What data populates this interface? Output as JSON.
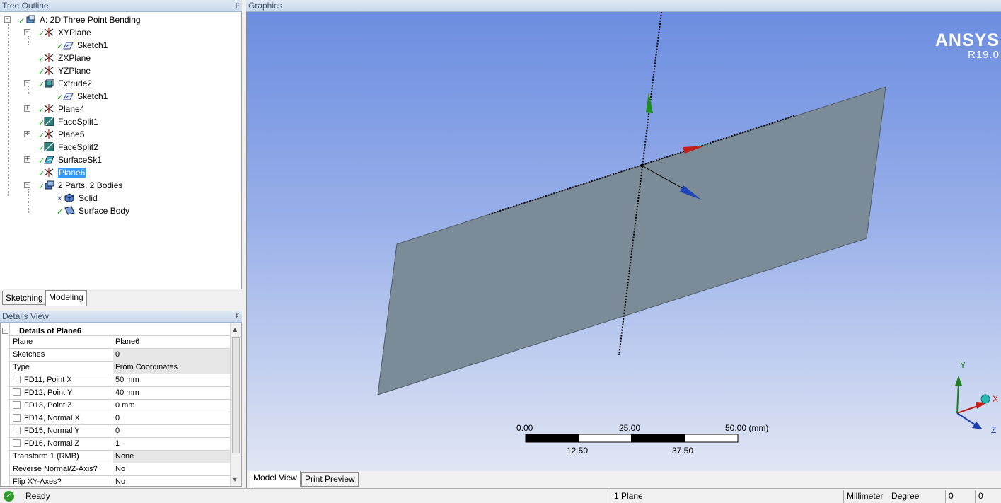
{
  "tree_outline": {
    "title": "Tree Outline",
    "nodes": [
      {
        "label": "A: 2D Three Point Bending",
        "icon": "model-icon"
      },
      {
        "label": "XYPlane",
        "icon": "plane-icon"
      },
      {
        "label": "Sketch1",
        "icon": "sketch-icon"
      },
      {
        "label": "ZXPlane",
        "icon": "plane-icon"
      },
      {
        "label": "YZPlane",
        "icon": "plane-icon"
      },
      {
        "label": "Extrude2",
        "icon": "extrude-icon"
      },
      {
        "label": "Sketch1",
        "icon": "sketch-icon"
      },
      {
        "label": "Plane4",
        "icon": "plane-icon"
      },
      {
        "label": "FaceSplit1",
        "icon": "facesplit-icon"
      },
      {
        "label": "Plane5",
        "icon": "plane-icon"
      },
      {
        "label": "FaceSplit2",
        "icon": "facesplit-icon"
      },
      {
        "label": "SurfaceSk1",
        "icon": "surface-sketch-icon"
      },
      {
        "label": "Plane6",
        "icon": "plane-icon"
      },
      {
        "label": "2 Parts, 2 Bodies",
        "icon": "parts-icon"
      },
      {
        "label": "Solid",
        "icon": "solid-body-icon"
      },
      {
        "label": "Surface Body",
        "icon": "surface-body-icon"
      }
    ]
  },
  "tabs": {
    "sketching": "Sketching",
    "modeling": "Modeling"
  },
  "details": {
    "title": "Details View",
    "heading": "Details of Plane6",
    "rows": [
      {
        "key": "Plane",
        "value": "Plane6"
      },
      {
        "key": "Sketches",
        "value": "0"
      },
      {
        "key": "Type",
        "value": "From Coordinates"
      },
      {
        "key": "FD11, Point X",
        "value": "50 mm"
      },
      {
        "key": "FD12, Point Y",
        "value": "40 mm"
      },
      {
        "key": "FD13, Point Z",
        "value": "0 mm"
      },
      {
        "key": "FD14, Normal X",
        "value": "0"
      },
      {
        "key": "FD15, Normal Y",
        "value": "0"
      },
      {
        "key": "FD16, Normal Z",
        "value": "1"
      },
      {
        "key": "Transform 1 (RMB)",
        "value": "None"
      },
      {
        "key": "Reverse Normal/Z-Axis?",
        "value": "No"
      },
      {
        "key": "Flip XY-Axes?",
        "value": "No"
      }
    ]
  },
  "graphics": {
    "title": "Graphics",
    "brand": "ANSYS",
    "version": "R19.0",
    "scale": {
      "l0": "0.00",
      "l25": "25.00",
      "l50": "50.00 (mm)",
      "l12": "12.50",
      "l37": "37.50"
    },
    "triad": {
      "x": "X",
      "y": "Y",
      "z": "Z"
    },
    "tab_model_view": "Model View",
    "tab_print_preview": "Print Preview"
  },
  "status": {
    "ready": "Ready",
    "selection": "1 Plane",
    "units_length": "Millimeter",
    "units_angle": "Degree",
    "c1": "0",
    "c2": "0"
  },
  "colors": {
    "accent": "#3399ff",
    "plane": "#7b8b97",
    "bg_top": "#6c8de0",
    "bg_bottom": "#e1e6f4"
  }
}
